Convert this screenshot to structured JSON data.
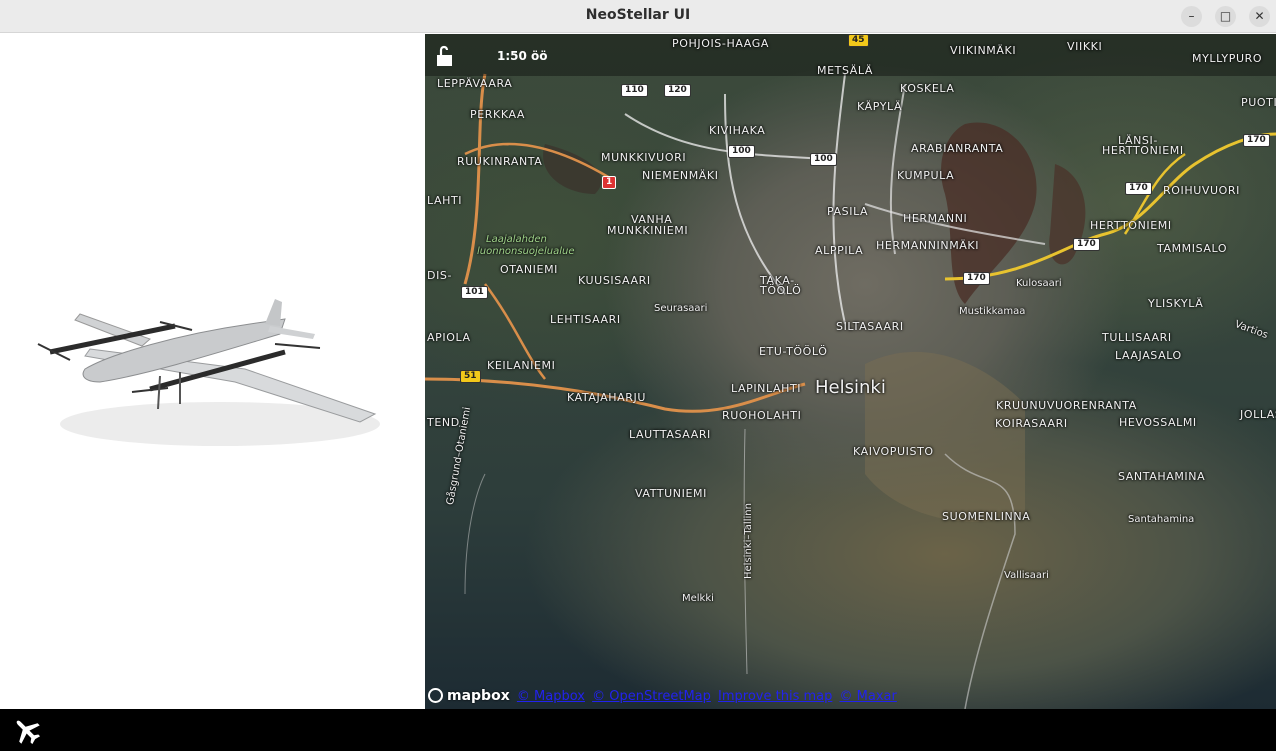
{
  "window": {
    "title": "NeoStellar UI",
    "controls": [
      "minimize-icon",
      "maximize-icon",
      "close-icon"
    ]
  },
  "left_panel": {
    "image": "vtol-drone-icon"
  },
  "map": {
    "topbar": {
      "lock_state": "unlocked",
      "lock_icon": "unlock-icon",
      "time": "1:50 öö"
    },
    "labels": [
      {
        "id": "helsinki",
        "text": "Helsinki",
        "kind": "city"
      },
      {
        "id": "pohjois-haaga",
        "text": "POHJOIS-HAAGA",
        "kind": "district"
      },
      {
        "id": "metsala",
        "text": "METSÄLÄ",
        "kind": "district"
      },
      {
        "id": "viikinmaki",
        "text": "VIIKINMÄKI",
        "kind": "district"
      },
      {
        "id": "viikki",
        "text": "VIIKKI",
        "kind": "district"
      },
      {
        "id": "myllypuro",
        "text": "MYLLYPURO",
        "kind": "district"
      },
      {
        "id": "leppavaara",
        "text": "LEPPÄVAARA",
        "kind": "district"
      },
      {
        "id": "perkkaa",
        "text": "PERKKAA",
        "kind": "district"
      },
      {
        "id": "koskela",
        "text": "KOSKELA",
        "kind": "district"
      },
      {
        "id": "kapyla",
        "text": "KÄPYLÄ",
        "kind": "district"
      },
      {
        "id": "puotinen",
        "text": "PUOTIN",
        "kind": "district"
      },
      {
        "id": "kivihaka",
        "text": "KIVIHAKA",
        "kind": "district"
      },
      {
        "id": "lansi-herttoniemi",
        "text": "LÄNSI-",
        "kind": "district"
      },
      {
        "id": "lansi-herttoniemi-2",
        "text": "HERTTONIEMI",
        "kind": "district"
      },
      {
        "id": "ruukinranta",
        "text": "RUUKINRANTA",
        "kind": "district"
      },
      {
        "id": "munkkivuori",
        "text": "MUNKKIVUORI",
        "kind": "district"
      },
      {
        "id": "arabianranta",
        "text": "ARABIANRANTA",
        "kind": "district"
      },
      {
        "id": "niemenmaki",
        "text": "NIEMENMÄKI",
        "kind": "district"
      },
      {
        "id": "kumpula",
        "text": "KUMPULA",
        "kind": "district"
      },
      {
        "id": "roihuvuori",
        "text": "ROIHUVUORI",
        "kind": "district"
      },
      {
        "id": "lahti",
        "text": "LAHTI",
        "kind": "district"
      },
      {
        "id": "pasila",
        "text": "PASILA",
        "kind": "district"
      },
      {
        "id": "hermanni",
        "text": "HERMANNI",
        "kind": "district"
      },
      {
        "id": "vanha",
        "text": "VANHA",
        "kind": "district"
      },
      {
        "id": "munkkiniemi",
        "text": "MUNKKINIEMI",
        "kind": "district"
      },
      {
        "id": "herttoniemi",
        "text": "HERTTONIEMI",
        "kind": "district"
      },
      {
        "id": "laajalahden",
        "text": "Laajalahden",
        "kind": "park"
      },
      {
        "id": "luonnonsuojelualue",
        "text": "luonnonsuojelualue",
        "kind": "park"
      },
      {
        "id": "alppila",
        "text": "ALPPILA",
        "kind": "district"
      },
      {
        "id": "hermanninmaki",
        "text": "HERMANNINMÄKI",
        "kind": "district"
      },
      {
        "id": "tammisalo",
        "text": "TAMMISALO",
        "kind": "district"
      },
      {
        "id": "otaniemi",
        "text": "OTANIEMI",
        "kind": "district"
      },
      {
        "id": "kuusisaari",
        "text": "KUUSISAARI",
        "kind": "district"
      },
      {
        "id": "taka",
        "text": "TAKA-",
        "kind": "district"
      },
      {
        "id": "toolo",
        "text": "TÖÖLÖ",
        "kind": "district"
      },
      {
        "id": "kulosaari",
        "text": "Kulosaari",
        "kind": "place"
      },
      {
        "id": "dis",
        "text": "DIS-",
        "kind": "district"
      },
      {
        "id": "seurasaari",
        "text": "Seurasaari",
        "kind": "place"
      },
      {
        "id": "mustikkamaa",
        "text": "Mustikkamaa",
        "kind": "place"
      },
      {
        "id": "yliskyla",
        "text": "YLISKYLÄ",
        "kind": "district"
      },
      {
        "id": "lehtisaari",
        "text": "LEHTISAARI",
        "kind": "district"
      },
      {
        "id": "siltasaari",
        "text": "SILTASAARI",
        "kind": "district"
      },
      {
        "id": "vartiosaari",
        "text": "Vartios",
        "kind": "place"
      },
      {
        "id": "apiola",
        "text": "APIOLA",
        "kind": "district"
      },
      {
        "id": "tullisaari",
        "text": "TULLISAARI",
        "kind": "district"
      },
      {
        "id": "etu-toolo",
        "text": "ETU-TÖÖLÖ",
        "kind": "district"
      },
      {
        "id": "laajasalo",
        "text": "LAAJASALO",
        "kind": "district"
      },
      {
        "id": "keilaniemi",
        "text": "KEILANIEMI",
        "kind": "district"
      },
      {
        "id": "lapinlahti",
        "text": "LAPINLAHTI",
        "kind": "district"
      },
      {
        "id": "katajaharju",
        "text": "KATAJAHARJU",
        "kind": "district"
      },
      {
        "id": "kruunuvuorenranta",
        "text": "KRUUNUVUORENRANTA",
        "kind": "district"
      },
      {
        "id": "ruoholahti",
        "text": "RUOHOLAHTI",
        "kind": "district"
      },
      {
        "id": "jollas",
        "text": "JOLLAS",
        "kind": "district"
      },
      {
        "id": "tend",
        "text": "TEND",
        "kind": "district"
      },
      {
        "id": "koirasaari",
        "text": "KOIRASAARI",
        "kind": "district"
      },
      {
        "id": "hevossalmi",
        "text": "HEVOSSALMI",
        "kind": "district"
      },
      {
        "id": "lauttasaari",
        "text": "LAUTTASAARI",
        "kind": "district"
      },
      {
        "id": "kaivopuisto",
        "text": "KAIVOPUISTO",
        "kind": "district"
      },
      {
        "id": "santahamina",
        "text": "SANTAHAMINA",
        "kind": "district"
      },
      {
        "id": "vattuniemi",
        "text": "VATTUNIEMI",
        "kind": "district"
      },
      {
        "id": "suomenlinna",
        "text": "SUOMENLINNA",
        "kind": "district"
      },
      {
        "id": "santahamina-place",
        "text": "Santahamina",
        "kind": "place"
      },
      {
        "id": "gasgrund",
        "text": "Gåsgrund–Otaniemi",
        "kind": "route"
      },
      {
        "id": "vallisaari",
        "text": "Vallisaari",
        "kind": "place"
      },
      {
        "id": "melkki",
        "text": "Melkki",
        "kind": "place"
      },
      {
        "id": "helsinki-tallinn",
        "text": "Helsinki–Tallinn",
        "kind": "route"
      }
    ],
    "road_shields": [
      {
        "id": "r45",
        "text": "45",
        "color": "yellow"
      },
      {
        "id": "r110",
        "text": "110",
        "color": "white"
      },
      {
        "id": "r120",
        "text": "120",
        "color": "white"
      },
      {
        "id": "r100a",
        "text": "100",
        "color": "white"
      },
      {
        "id": "r100b",
        "text": "100",
        "color": "white"
      },
      {
        "id": "r1",
        "text": "1",
        "color": "red"
      },
      {
        "id": "r170a",
        "text": "170",
        "color": "white"
      },
      {
        "id": "r170b",
        "text": "170",
        "color": "white"
      },
      {
        "id": "r170c",
        "text": "170",
        "color": "white"
      },
      {
        "id": "r170d",
        "text": "170",
        "color": "white"
      },
      {
        "id": "r101",
        "text": "101",
        "color": "white"
      },
      {
        "id": "r51",
        "text": "51",
        "color": "yellow"
      }
    ],
    "attribution": {
      "logo": "mapbox",
      "links": [
        "© Mapbox",
        "© OpenStreetMap",
        "Improve this map",
        "© Maxar"
      ]
    }
  },
  "bottombar": {
    "icon": "airplane-icon"
  }
}
